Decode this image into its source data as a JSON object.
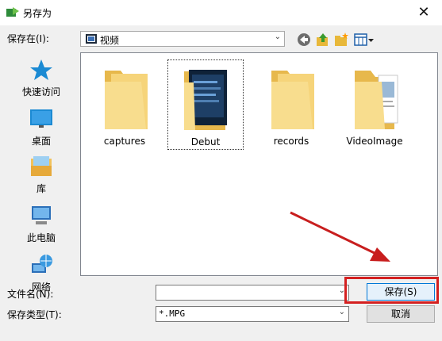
{
  "window": {
    "title": "另存为",
    "close_glyph": "✕"
  },
  "save_in": {
    "label": "保存在(I):",
    "value": "视频",
    "icon": "video-folder-icon"
  },
  "toolbar": {
    "icons": [
      "back-icon",
      "up-folder-icon",
      "new-folder-icon",
      "view-menu-icon"
    ]
  },
  "places": [
    {
      "label": "快速访问",
      "icon": "star-icon"
    },
    {
      "label": "桌面",
      "icon": "desktop-icon"
    },
    {
      "label": "库",
      "icon": "library-icon"
    },
    {
      "label": "此电脑",
      "icon": "computer-icon"
    },
    {
      "label": "网络",
      "icon": "network-icon"
    }
  ],
  "files": [
    {
      "name": "captures",
      "selected": false
    },
    {
      "name": "Debut",
      "selected": true
    },
    {
      "name": "records",
      "selected": false
    },
    {
      "name": "VideoImage",
      "selected": false
    }
  ],
  "form": {
    "filename_label": "文件名(N):",
    "filename_value": "",
    "filetype_label": "保存类型(T):",
    "filetype_value": "*.MPG"
  },
  "buttons": {
    "save": "保存(S)",
    "cancel": "取消"
  },
  "colors": {
    "highlight": "#d42020",
    "folder": "#f5cf6a",
    "accent": "#0078d7"
  }
}
